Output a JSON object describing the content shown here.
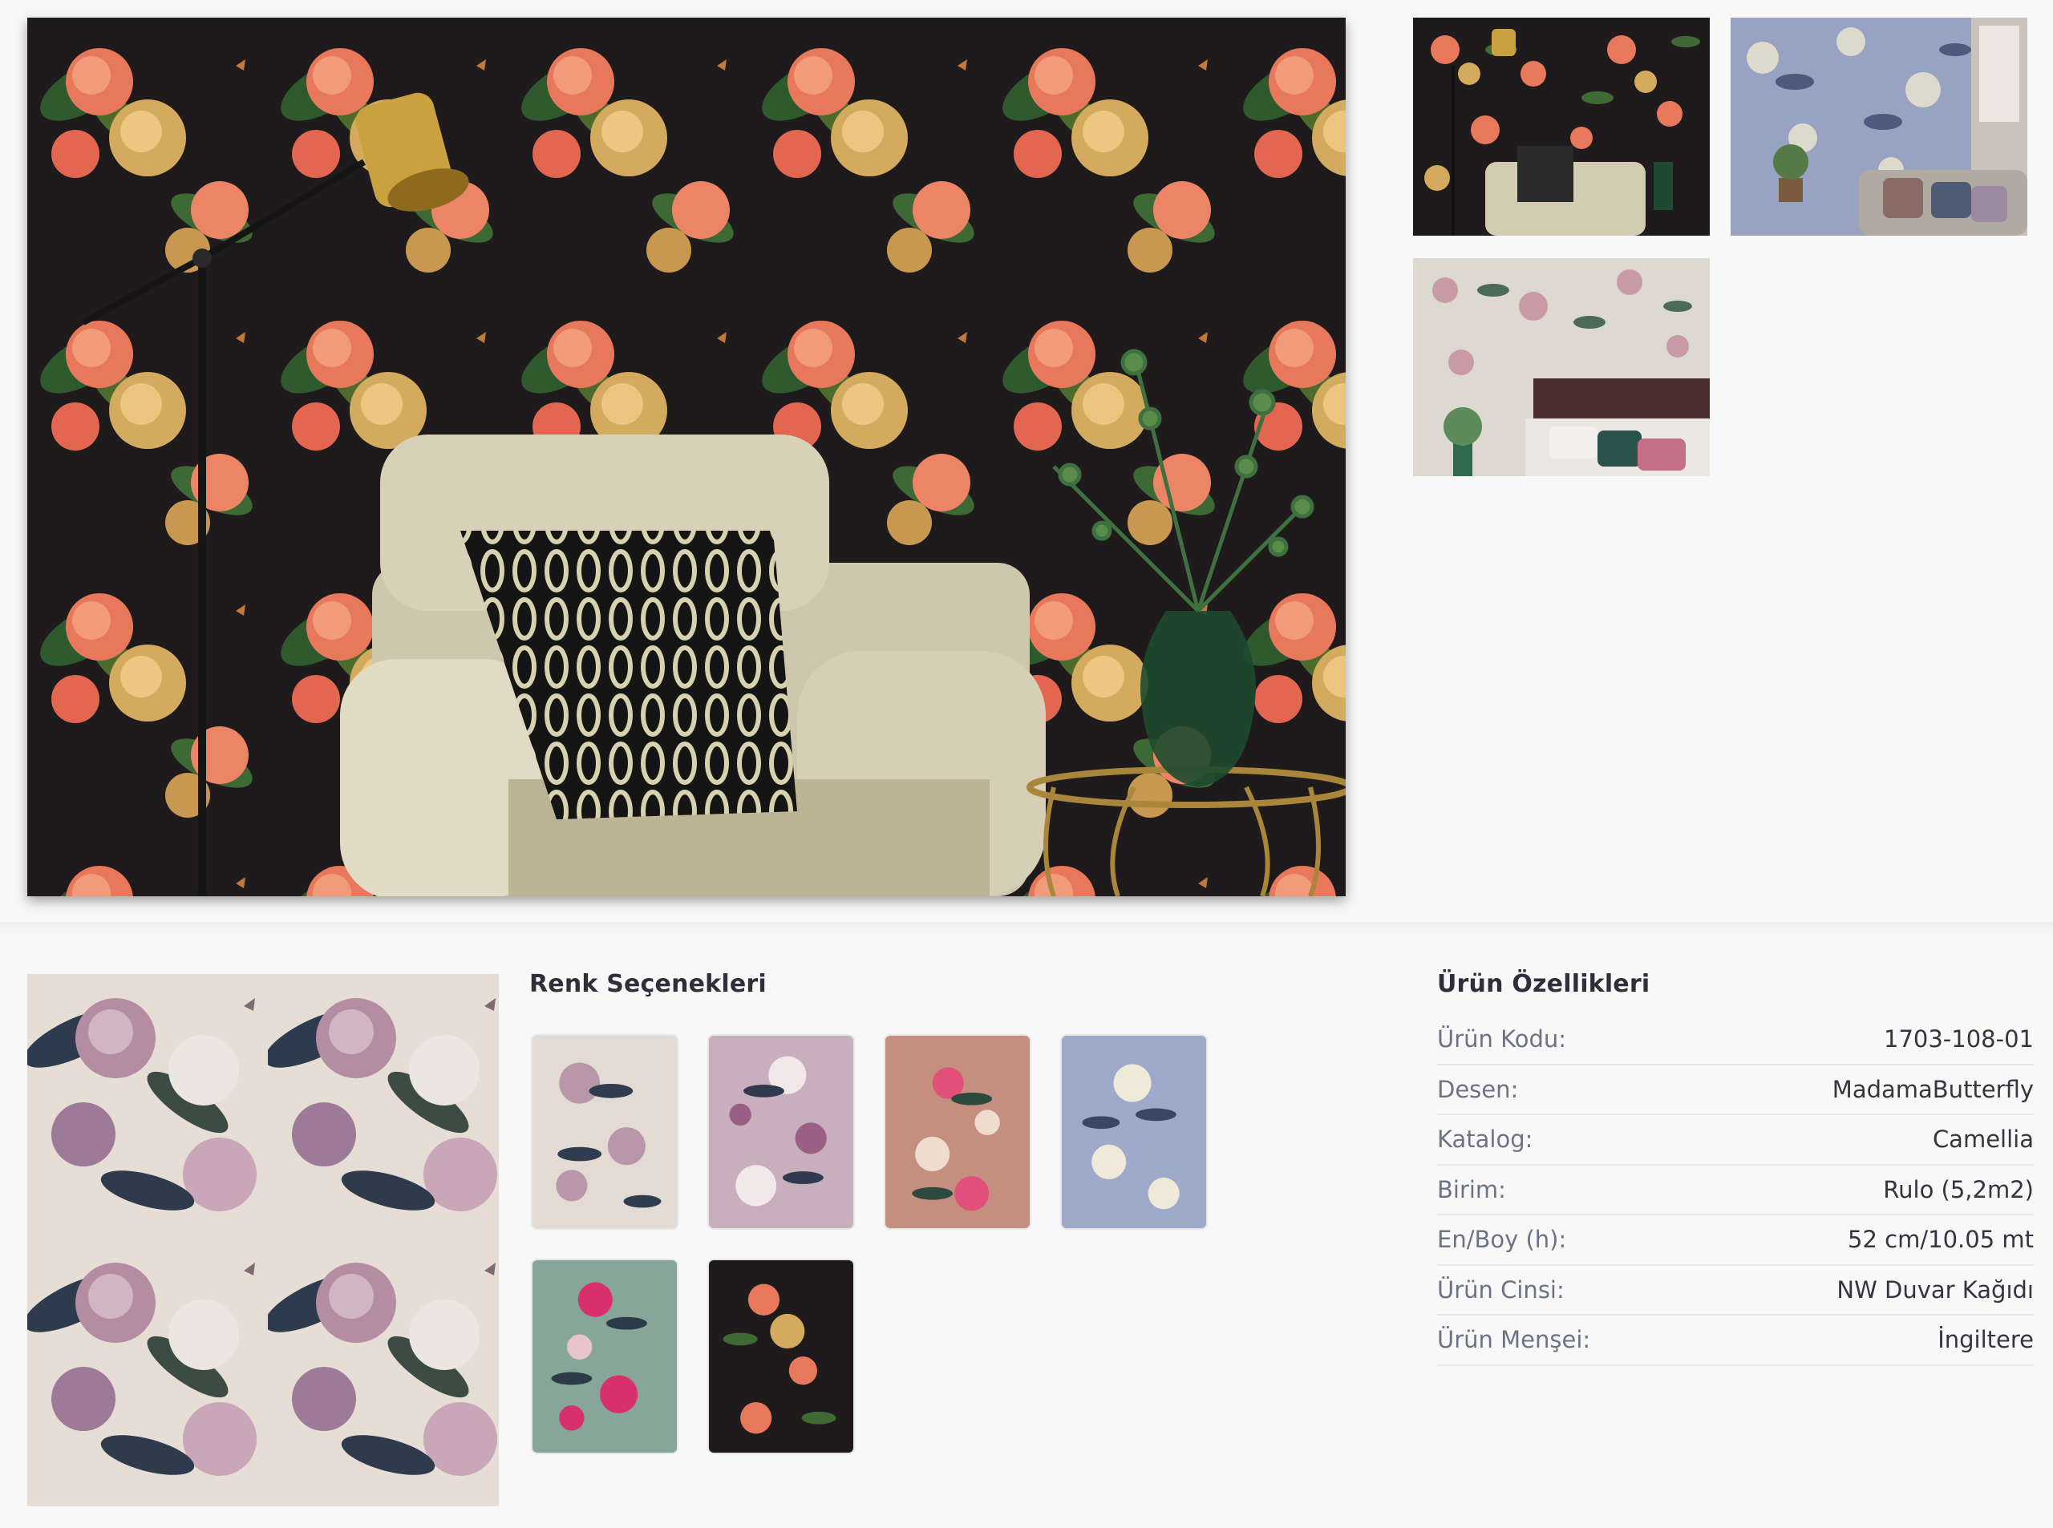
{
  "gallery": {
    "main_alt": "Dark floral wallpaper room scene",
    "thumbnails": [
      "dark-room",
      "blue-room",
      "bedroom"
    ]
  },
  "colors": {
    "title": "Renk Seçenekleri",
    "swatches": [
      "cream",
      "lilac",
      "rose",
      "blue",
      "teal",
      "black"
    ]
  },
  "specs": {
    "title": "Ürün Özellikleri",
    "rows": [
      {
        "label": "Ürün Kodu:",
        "value": "1703-108-01"
      },
      {
        "label": "Desen:",
        "value": "MadamaButterfly"
      },
      {
        "label": "Katalog:",
        "value": "Camellia"
      },
      {
        "label": "Birim:",
        "value": "Rulo (5,2m2)"
      },
      {
        "label": "En/Boy (h):",
        "value": "52 cm/10.05 mt"
      },
      {
        "label": "Ürün Cinsi:",
        "value": "NW Duvar Kağıdı"
      },
      {
        "label": "Ürün Menşei:",
        "value": "İngiltere"
      }
    ]
  }
}
